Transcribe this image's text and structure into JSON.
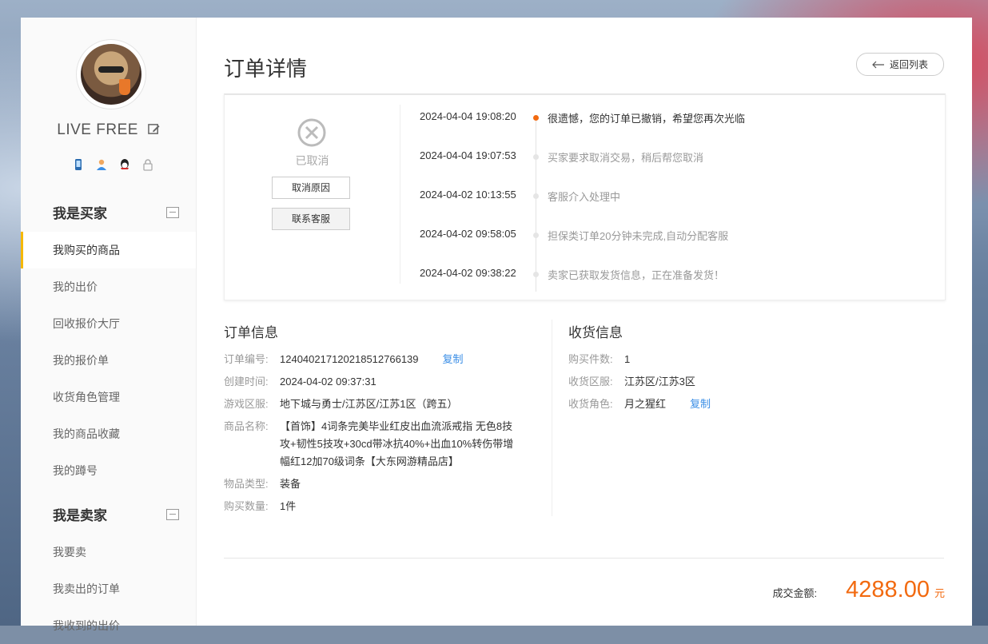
{
  "user": {
    "name": "LIVE FREE"
  },
  "sidebar": {
    "buyer": {
      "title": "我是买家",
      "items": [
        "我购买的商品",
        "我的出价",
        "回收报价大厅",
        "我的报价单",
        "收货角色管理",
        "我的商品收藏",
        "我的蹲号"
      ]
    },
    "seller": {
      "title": "我是卖家",
      "items": [
        "我要卖",
        "我卖出的订单",
        "我收到的出价"
      ]
    }
  },
  "page": {
    "title": "订单详情",
    "back_label": "返回列表"
  },
  "status": {
    "label": "已取消",
    "cancel_reason_btn": "取消原因",
    "contact_btn": "联系客服"
  },
  "timeline": [
    {
      "time": "2024-04-04 19:08:20",
      "message": "很遗憾，您的订单已撤销，希望您再次光临"
    },
    {
      "time": "2024-04-04 19:07:53",
      "message": "买家要求取消交易，稍后帮您取消"
    },
    {
      "time": "2024-04-02 10:13:55",
      "message": "客服介入处理中"
    },
    {
      "time": "2024-04-02 09:58:05",
      "message": "担保类订单20分钟未完成,自动分配客服"
    },
    {
      "time": "2024-04-02 09:38:22",
      "message": "卖家已获取发货信息，正在准备发货！"
    }
  ],
  "order_info": {
    "title": "订单信息",
    "order_no_label": "订单编号:",
    "order_no": "124040217120218512766139",
    "copy_label": "复制",
    "created_label": "创建时间:",
    "created": "2024-04-02 09:37:31",
    "server_label": "游戏区服:",
    "server": "地下城与勇士/江苏区/江苏1区（跨五）",
    "product_label": "商品名称:",
    "product_lines": [
      "【首饰】4词条完美毕业红皮出血流派戒指 无色8技",
      "攻+韧性5技攻+30cd带冰抗40%+出血10%转伤带增",
      "幅红12加70级词条【大东网游精品店】"
    ],
    "type_label": "物品类型:",
    "type": "装备",
    "qty_label": "购买数量:",
    "qty": "1件"
  },
  "delivery_info": {
    "title": "收货信息",
    "count_label": "购买件数:",
    "count": "1",
    "server_label": "收货区服:",
    "server": "江苏区/江苏3区",
    "role_label": "收货角色:",
    "role": "月之猩红",
    "copy_label": "复制"
  },
  "total": {
    "label": "成交金额:",
    "amount": "4288.00",
    "unit": "元"
  },
  "colors": {
    "accent": "#f26a10",
    "link": "#3a8ee6",
    "active_bar": "#f5b800"
  }
}
